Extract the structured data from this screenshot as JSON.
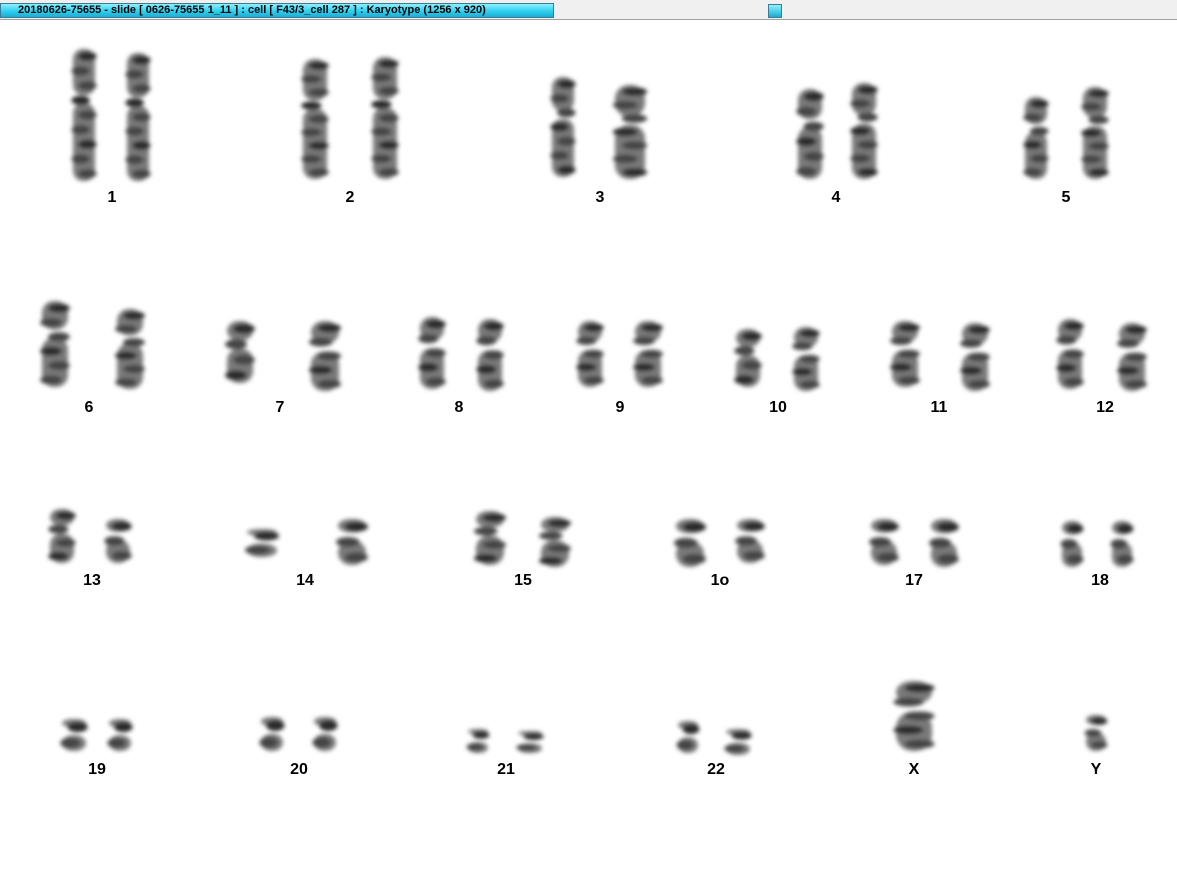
{
  "window": {
    "title": "20180626-75655 - slide [ 0626-75655 1_11 ] : cell [ F43/3_cell 287 ] : Karyotype  (1256 x 920)"
  },
  "karyotype": {
    "labels": [
      "1",
      "2",
      "3",
      "4",
      "5",
      "6",
      "7",
      "8",
      "9",
      "10",
      "11",
      "12",
      "13",
      "14",
      "15",
      "1o",
      "17",
      "18",
      "19",
      "20",
      "21",
      "22",
      "X",
      "Y"
    ]
  }
}
